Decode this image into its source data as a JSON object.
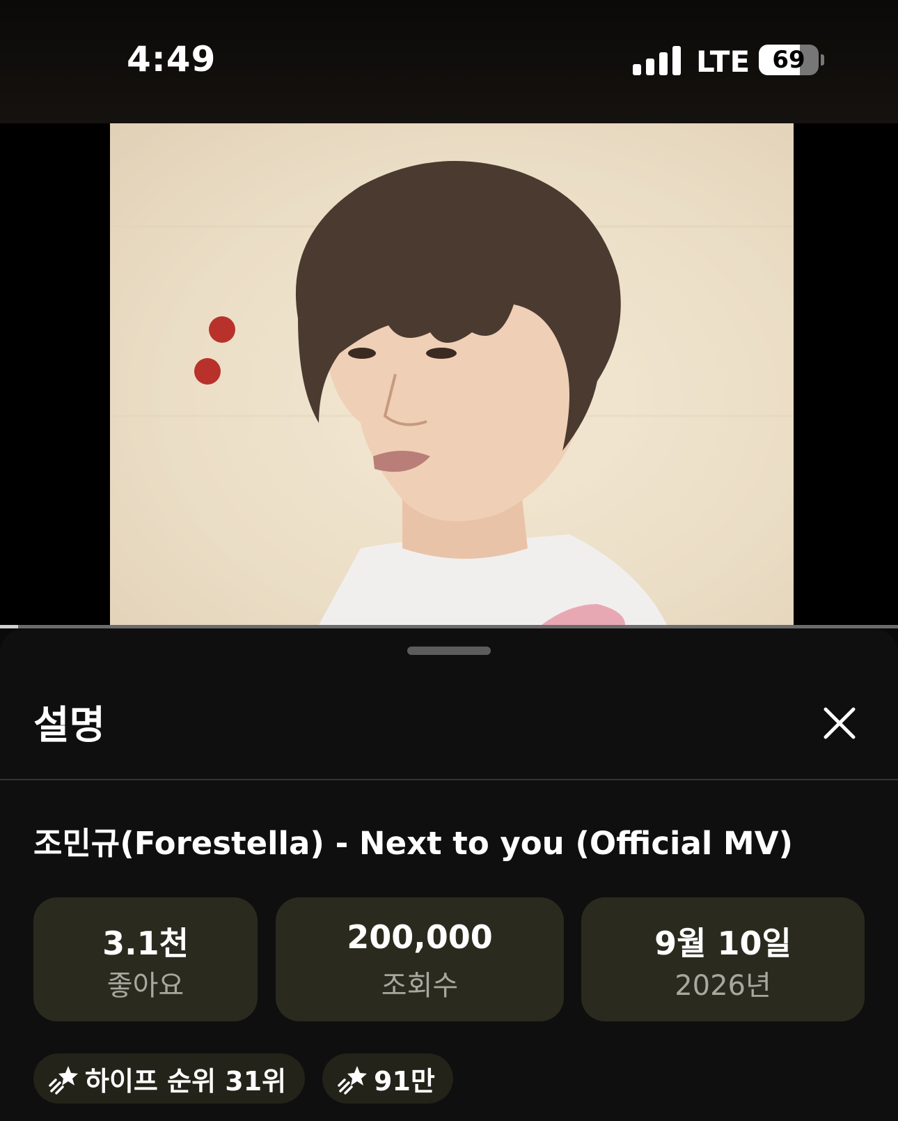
{
  "status_bar": {
    "time": "4:49",
    "network": "LTE",
    "battery": "69",
    "battery_level": 0.69
  },
  "video": {
    "progress": 0.02
  },
  "sheet": {
    "title": "설명",
    "video_title": "조민규(Forestella) - Next to you (Official MV)",
    "stats": [
      {
        "value": "3.1천",
        "label": "좋아요"
      },
      {
        "value": "200,000",
        "label": "조회수"
      },
      {
        "value": "9월 10일",
        "label": "2026년"
      }
    ],
    "chips": [
      {
        "label": "하이프 순위 31위",
        "icon": "hype-icon"
      },
      {
        "label": "91만",
        "icon": "hype-icon"
      }
    ]
  },
  "colors": {
    "card_bg": "#2a2b1e",
    "chip_bg": "#232319",
    "sheet_bg": "#0f0f0f"
  }
}
